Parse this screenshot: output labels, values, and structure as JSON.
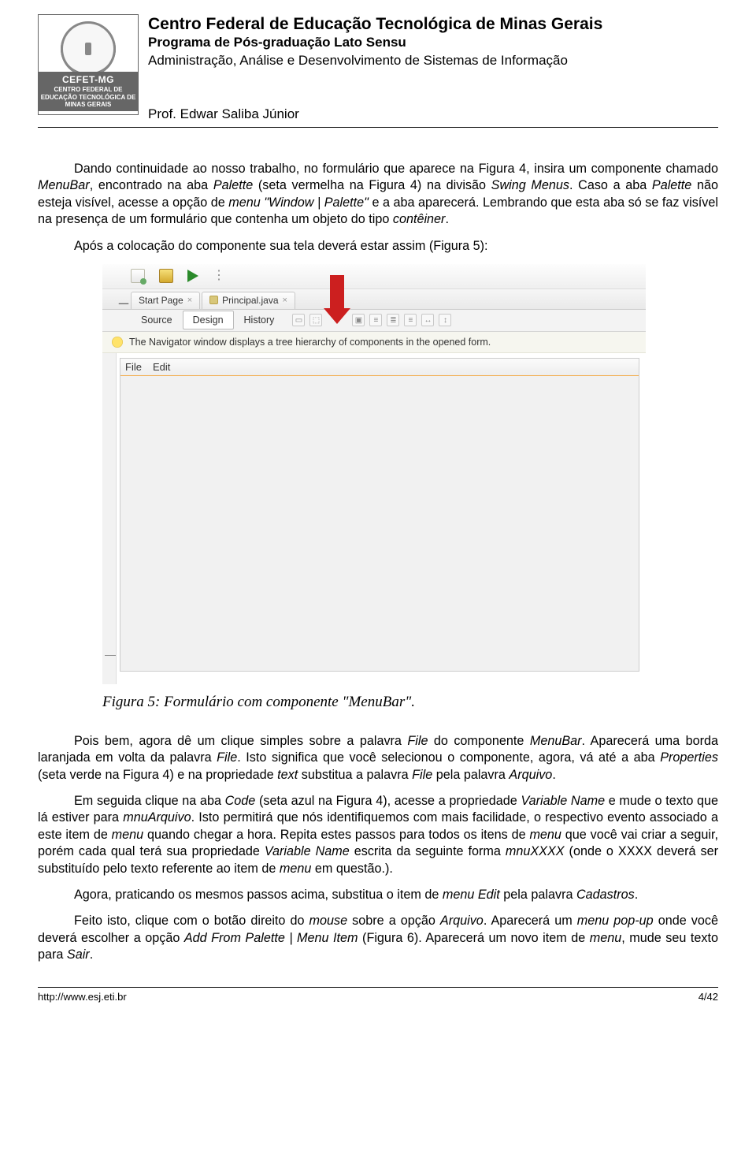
{
  "header": {
    "institution": "Centro Federal de Educação Tecnológica de Minas Gerais",
    "program": "Programa de Pós-graduação Lato Sensu",
    "course": "Administração, Análise e Desenvolvimento de Sistemas de Informação",
    "professor": "Prof. Edwar Saliba Júnior",
    "logo_main": "CEFET-MG",
    "logo_sub": "CENTRO FEDERAL DE EDUCAÇÃO TECNOLÓGICA DE MINAS GERAIS"
  },
  "paragraphs": {
    "p1a": "Dando continuidade ao nosso trabalho, no formulário que aparece na Figura 4, insira um componente chamado ",
    "p1b": "MenuBar",
    "p1c": ", encontrado na aba ",
    "p1d": "Palette",
    "p1e": " (seta vermelha na Figura 4) na divisão ",
    "p1f": "Swing Menus",
    "p1g": ". Caso a aba ",
    "p1h": "Palette",
    "p1i": " não esteja visível, acesse a opção de ",
    "p1j": "menu \"Window | Palette\"",
    "p1k": " e a aba aparecerá. Lembrando que esta aba só se faz visível na presença de um formulário que contenha um objeto do tipo ",
    "p1l": "contêiner",
    "p1m": ".",
    "p2": "Após a colocação do componente sua tela deverá estar assim (Figura 5):",
    "p3a": "Pois bem, agora dê um clique simples sobre a palavra ",
    "p3b": "File",
    "p3c": " do componente ",
    "p3d": "MenuBar",
    "p3e": ". Aparecerá uma borda laranjada em volta da palavra ",
    "p3f": "File",
    "p3g": ". Isto significa que você selecionou o componente, agora, vá até a aba ",
    "p3h": "Properties",
    "p3i": " (seta verde na Figura 4) e na propriedade ",
    "p3j": "text",
    "p3k": " substitua a palavra ",
    "p3l": "File",
    "p3m": " pela palavra ",
    "p3n": "Arquivo",
    "p3o": ".",
    "p4a": "Em seguida clique na aba ",
    "p4b": "Code",
    "p4c": " (seta azul na Figura 4), acesse a propriedade ",
    "p4d": "Variable Name",
    "p4e": " e mude o texto que lá estiver para ",
    "p4f": "mnuArquivo",
    "p4g": ". Isto permitirá que nós identifiquemos com mais facilidade, o respectivo evento associado a este item de ",
    "p4h": "menu",
    "p4i": " quando chegar a hora. Repita estes passos para todos os itens de ",
    "p4j": "menu",
    "p4k": " que você vai criar a seguir, porém cada qual terá sua propriedade ",
    "p4l": "Variable Name",
    "p4m": " escrita da seguinte forma ",
    "p4n": "mnuXXXX",
    "p4o": " (onde o XXXX deverá ser substituído pelo texto referente ao item de ",
    "p4p": "menu",
    "p4q": " em questão.).",
    "p5a": "Agora, praticando os mesmos passos acima, substitua o item de ",
    "p5b": "menu Edit",
    "p5c": " pela palavra ",
    "p5d": "Cadastros",
    "p5e": ".",
    "p6a": "Feito isto, clique com o botão direito do ",
    "p6b": "mouse",
    "p6c": " sobre a opção ",
    "p6d": "Arquivo",
    "p6e": ". Aparecerá um ",
    "p6f": "menu pop-up",
    "p6g": " onde você deverá escolher a opção ",
    "p6h": "Add From Palette | Menu Item",
    "p6i": " (Figura 6). Aparecerá um novo item de ",
    "p6j": "menu",
    "p6k": ", mude seu texto para ",
    "p6l": "Sair",
    "p6m": "."
  },
  "ide": {
    "tab1": "Start Page",
    "tab2": "Principal.java",
    "mode_source": "Source",
    "mode_design": "Design",
    "mode_history": "History",
    "hint": "The Navigator window displays a tree hierarchy of components in the opened form.",
    "menu_file": "File",
    "menu_edit": "Edit"
  },
  "caption": "Figura 5: Formulário com componente \"MenuBar\".",
  "footer": {
    "url": "http://www.esj.eti.br",
    "page": "4/42"
  }
}
